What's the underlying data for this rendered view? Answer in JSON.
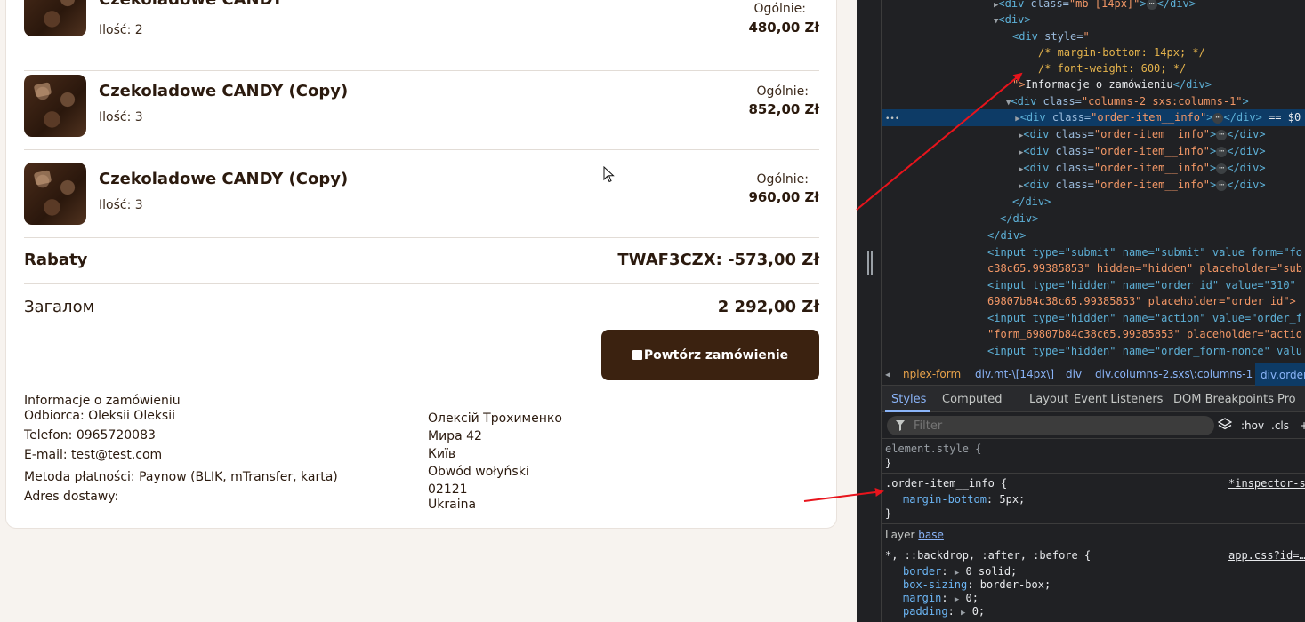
{
  "order": {
    "items": [
      {
        "title": "Czekoladowe CANDY",
        "qty": "Ilość: 2",
        "total_label": "Ogólnie:",
        "total": "480,00 Zł"
      },
      {
        "title": "Czekoladowe CANDY (Copy)",
        "qty": "Ilość: 3",
        "total_label": "Ogólnie:",
        "total": "852,00 Zł"
      },
      {
        "title": "Czekoladowe CANDY (Copy)",
        "qty": "Ilość: 3",
        "total_label": "Ogólnie:",
        "total": "960,00 Zł"
      }
    ],
    "discounts_label": "Rabaty",
    "discounts_value": "TWAF3CZX: -573,00 Zł",
    "total_label": "Загалом",
    "total_value": "2 292,00 Zł",
    "repeat_button": "Powtórz zamówienie"
  },
  "info": {
    "heading": "Informacje o zamówieniu",
    "recipient": "Odbiorca: Oleksii Oleksii",
    "phone": "Telefon: 0965720083",
    "email": "E-mail: test@test.com",
    "payment": "Metoda płatności: Paynow (BLIK, mTransfer, karta)",
    "address_label": "Adres dostawy:",
    "address_lines": [
      "Олексій Трохименко",
      "Мира 42",
      "Київ",
      "Obwód wołyński",
      "02121",
      "Ukraina"
    ]
  },
  "devtools": {
    "dom": {
      "l0_tag": "<div ",
      "l0_attr": "class=",
      "l0_val": "\"mb-[14px]\"",
      "l0_end": "</div>",
      "l1": "<div>",
      "l2_tag": "<div ",
      "l2_attr": "style=",
      "l2_val": "\"",
      "l3": "/* margin-bottom: 14px; */",
      "l4": "/* font-weight: 600; */",
      "l5_q": "\">",
      "l5_text": "Informacje o zamówieniu",
      "l5_end": "</div>",
      "l6_tag": "<div ",
      "l6_attr": "class=",
      "l6_val": "\"columns-2 sxs:columns-1\"",
      "l6_end": ">",
      "item_tag": "<div ",
      "item_attr": "class=",
      "item_val": "\"order-item__info\"",
      "item_end": "</div>",
      "sel_suffix": "== $0",
      "close_div": "</div>",
      "in1": "<input type=\"submit\" name=\"submit\" value form=\"fo",
      "in1b": "c38c65.99385853\" hidden=\"hidden\" placeholder=\"sub",
      "in2": "<input type=\"hidden\" name=\"order_id\" value=\"310\"",
      "in2b": "69807b84c38c65.99385853\" placeholder=\"order_id\">",
      "in3": "<input type=\"hidden\" name=\"action\" value=\"order_f",
      "in3b": "\"form_69807b84c38c65.99385853\" placeholder=\"actio",
      "in4": "<input type=\"hidden\" name=\"order_form-nonce\" valu",
      "ellipsis": "•••"
    },
    "breadcrumbs": [
      "nplex-form",
      "div.mt-\\[14px\\]",
      "div",
      "div.columns-2.sxs\\:columns-1",
      "div.order"
    ],
    "tabs": [
      "Styles",
      "Computed",
      "Layout",
      "Event Listeners",
      "DOM Breakpoints",
      "Pro"
    ],
    "filter_placeholder": "Filter",
    "hov": ":hov",
    "cls": ".cls",
    "styles": {
      "element_style": "element.style {",
      "close": "}",
      "rule_selector": ".order-item__info {",
      "rule_source": "*inspector-s",
      "rule_prop": "margin-bottom",
      "rule_val": "5px;",
      "layer_label": "Layer",
      "layer_name": "base",
      "universal_selector": "*, ::backdrop, :after, :before {",
      "universal_source": "app.css?id=…",
      "p1": "border",
      "v1": "0 solid;",
      "p2": "box-sizing",
      "v2": "border-box;",
      "p3": "margin",
      "v3": "0;",
      "p4": "padding",
      "v4": "0;"
    }
  },
  "colors": {
    "accent": "#3b2210",
    "annotation": "#e8141c",
    "devtools_bg": "#202124"
  }
}
